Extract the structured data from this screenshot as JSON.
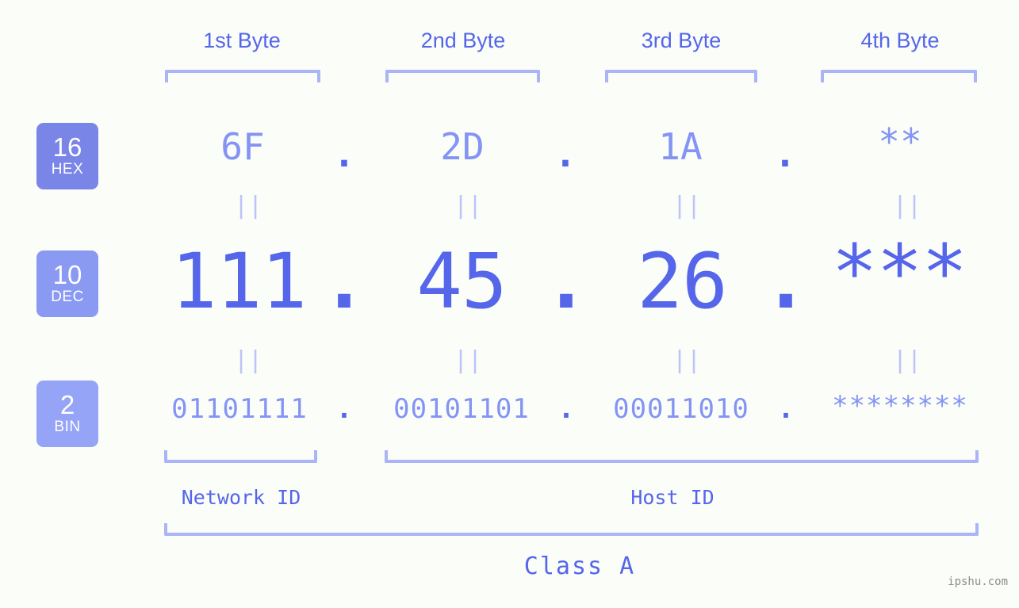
{
  "page": {
    "background_color": "#fbfdf8",
    "accent_color": "#5566ea",
    "accent_light_color": "#8494f4",
    "bracket_color": "#aab4f7",
    "watermark": "ipshu.com"
  },
  "headers": {
    "bytes": [
      {
        "label": "1st Byte"
      },
      {
        "label": "2nd Byte"
      },
      {
        "label": "3rd Byte"
      },
      {
        "label": "4th Byte"
      }
    ]
  },
  "bases": [
    {
      "num": "16",
      "abbr": "HEX",
      "color": "#7a85e8"
    },
    {
      "num": "10",
      "abbr": "DEC",
      "color": "#8a99f2"
    },
    {
      "num": "2",
      "abbr": "BIN",
      "color": "#95a4f6"
    }
  ],
  "rows": {
    "hex": {
      "name": "HEX",
      "values": [
        "6F",
        "2D",
        "1A",
        "**"
      ],
      "separator": "."
    },
    "dec": {
      "name": "DEC",
      "values": [
        "111",
        "45",
        "26",
        "***"
      ],
      "separator": "."
    },
    "bin": {
      "name": "BIN",
      "values": [
        "01101111",
        "00101101",
        "00011010",
        "********"
      ],
      "separator": "."
    }
  },
  "equals_marks": {
    "symbol": "||",
    "count_per_row": 4
  },
  "footer": {
    "segments": [
      {
        "label": "Network ID"
      },
      {
        "label": "Host ID"
      }
    ],
    "class": {
      "label": "Class A"
    }
  }
}
